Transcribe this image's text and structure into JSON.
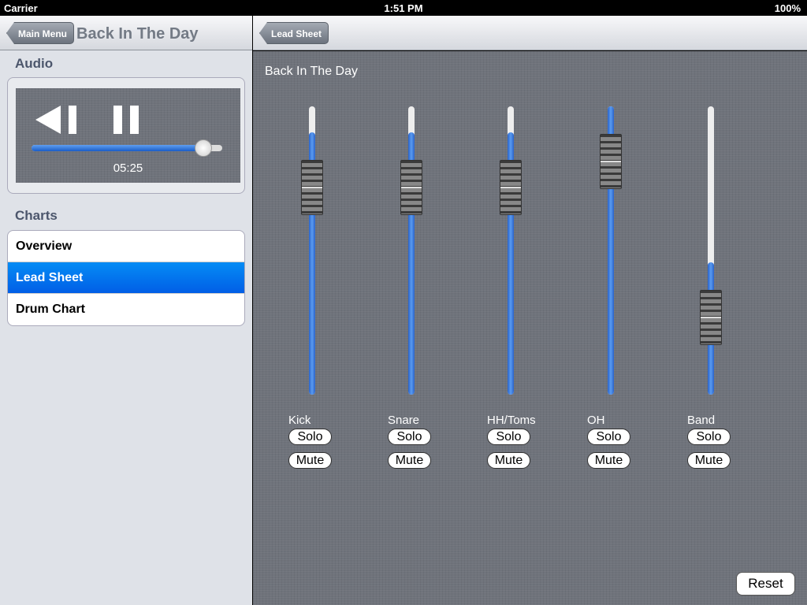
{
  "status": {
    "carrier": "Carrier",
    "time": "1:51 PM",
    "battery": "100%"
  },
  "sidebar": {
    "back_label": "Main Menu",
    "title": "Back In The Day",
    "audio_heading": "Audio",
    "elapsed": "05:25",
    "progress": 0.9,
    "charts_heading": "Charts",
    "charts": [
      {
        "label": "Overview",
        "selected": false
      },
      {
        "label": "Lead Sheet",
        "selected": true
      },
      {
        "label": "Drum Chart",
        "selected": false
      }
    ]
  },
  "main": {
    "back_label": "Lead Sheet",
    "title": "Back In The Day",
    "reset_label": "Reset",
    "channels": [
      {
        "label": "Kick",
        "level": 0.77,
        "solo": "Solo",
        "mute": "Mute"
      },
      {
        "label": "Snare",
        "level": 0.77,
        "solo": "Solo",
        "mute": "Mute"
      },
      {
        "label": "HH/Toms",
        "level": 0.77,
        "solo": "Solo",
        "mute": "Mute"
      },
      {
        "label": "OH",
        "level": 0.88,
        "solo": "Solo",
        "mute": "Mute"
      },
      {
        "label": "Band",
        "level": 0.21,
        "solo": "Solo",
        "mute": "Mute"
      }
    ]
  },
  "colors": {
    "accent": "#0a6ff0",
    "linen": "#6f737b"
  }
}
